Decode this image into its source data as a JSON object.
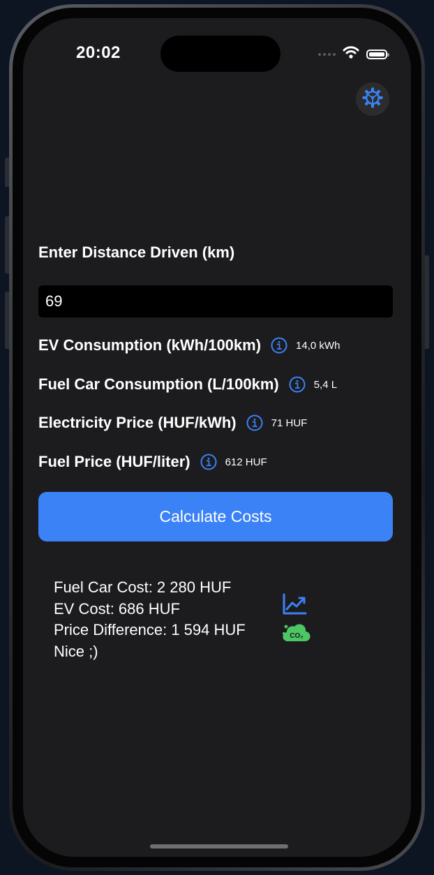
{
  "status_bar": {
    "time": "20:02"
  },
  "form": {
    "distance_label": "Enter Distance Driven (km)",
    "distance_value": "69",
    "params": [
      {
        "label": "EV Consumption (kWh/100km)",
        "value": "14,0 kWh"
      },
      {
        "label": "Fuel Car Consumption (L/100km)",
        "value": "5,4 L"
      },
      {
        "label": "Electricity Price (HUF/kWh)",
        "value": "71 HUF"
      },
      {
        "label": "Fuel Price (HUF/liter)",
        "value": "612 HUF"
      }
    ],
    "calculate_label": "Calculate Costs"
  },
  "results": {
    "fuel_car_cost": "Fuel Car Cost: 2 280 HUF",
    "ev_cost": "EV Cost: 686 HUF",
    "price_difference": "Price Difference: 1 594 HUF",
    "comment": "Nice ;)"
  },
  "icons": {
    "settings": "gear-icon",
    "info": "info-circle-icon",
    "chart": "chart-line-uptrend-icon",
    "co2": "co2-cloud-icon",
    "co2_text": "CO₂"
  },
  "colors": {
    "accent": "#3b82f6",
    "background": "#1c1c1e",
    "input_background": "#000000",
    "co2_green": "#4cc764"
  }
}
